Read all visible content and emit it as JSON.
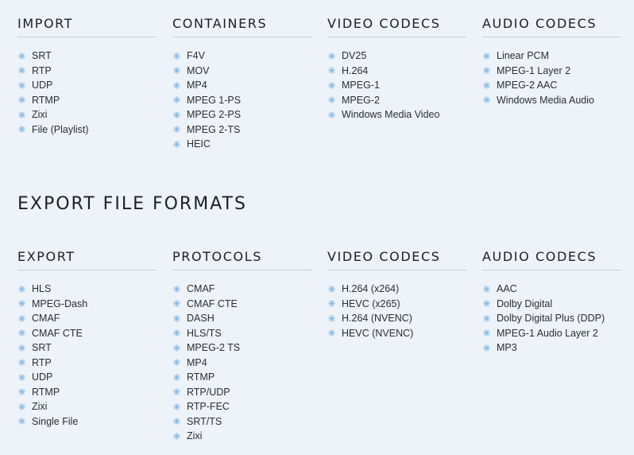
{
  "import_section": {
    "columns": [
      {
        "title": "IMPORT",
        "items": [
          "SRT",
          "RTP",
          "UDP",
          "RTMP",
          "Zixi",
          "File (Playlist)"
        ]
      },
      {
        "title": "CONTAINERS",
        "items": [
          "F4V",
          "MOV",
          "MP4",
          "MPEG 1-PS",
          "MPEG 2-PS",
          "MPEG 2-TS",
          "HEIC"
        ]
      },
      {
        "title": "VIDEO CODECS",
        "items": [
          "DV25",
          "H.264",
          "MPEG-1",
          "MPEG-2",
          "Windows Media Video"
        ]
      },
      {
        "title": "AUDIO CODECS",
        "items": [
          "Linear PCM",
          "MPEG-1 Layer 2",
          "MPEG-2 AAC",
          "Windows Media Audio"
        ]
      }
    ]
  },
  "export_section": {
    "heading": "EXPORT FILE FORMATS",
    "columns": [
      {
        "title": "EXPORT",
        "items": [
          "HLS",
          "MPEG-Dash",
          "CMAF",
          "CMAF CTE",
          "SRT",
          "RTP",
          "UDP",
          "RTMP",
          "Zixi",
          "Single File"
        ]
      },
      {
        "title": "PROTOCOLS",
        "items": [
          "CMAF",
          "CMAF CTE",
          "DASH",
          "HLS/TS",
          "MPEG-2 TS",
          "MP4",
          "RTMP",
          "RTP/UDP",
          "RTP-FEC",
          "SRT/TS",
          "Zixi"
        ]
      },
      {
        "title": "VIDEO CODECS",
        "items": [
          "H.264 (x264)",
          "HEVC (x265)",
          "H.264 (NVENC)",
          "HEVC (NVENC)"
        ]
      },
      {
        "title": "AUDIO CODECS",
        "items": [
          "AAC",
          "Dolby Digital",
          "Dolby Digital Plus (DDP)",
          "MPEG-1 Audio Layer 2",
          "MP3"
        ]
      }
    ]
  },
  "style": {
    "bullet_icon": "snowflake-bullet-icon",
    "bullet_color": "#8fbfe6",
    "background": "#eef3fa"
  }
}
